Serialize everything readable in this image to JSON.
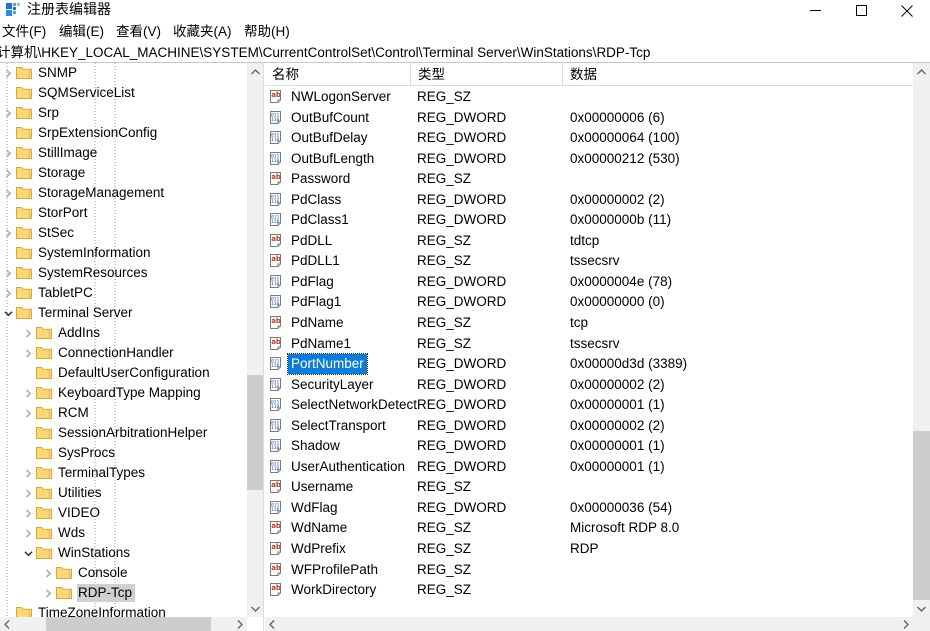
{
  "window": {
    "title": "注册表编辑器",
    "app_icon": "registry-editor-icon",
    "controls": {
      "minimize": "minimize-icon",
      "maximize": "maximize-icon",
      "close": "close-icon"
    }
  },
  "menubar": {
    "items": [
      {
        "label": "文件(F)"
      },
      {
        "label": "编辑(E)"
      },
      {
        "label": "查看(V)"
      },
      {
        "label": "收藏夹(A)"
      },
      {
        "label": "帮助(H)"
      }
    ]
  },
  "address": {
    "path": "计算机\\HKEY_LOCAL_MACHINE\\SYSTEM\\CurrentControlSet\\Control\\Terminal Server\\WinStations\\RDP-Tcp"
  },
  "tree": {
    "nodes": [
      {
        "label": "SNMP",
        "depth": 1,
        "twist": "collapsed",
        "selected": false
      },
      {
        "label": "SQMServiceList",
        "depth": 1,
        "twist": "none",
        "selected": false
      },
      {
        "label": "Srp",
        "depth": 1,
        "twist": "collapsed",
        "selected": false
      },
      {
        "label": "SrpExtensionConfig",
        "depth": 1,
        "twist": "none",
        "selected": false
      },
      {
        "label": "StillImage",
        "depth": 1,
        "twist": "collapsed",
        "selected": false
      },
      {
        "label": "Storage",
        "depth": 1,
        "twist": "collapsed",
        "selected": false
      },
      {
        "label": "StorageManagement",
        "depth": 1,
        "twist": "collapsed",
        "selected": false
      },
      {
        "label": "StorPort",
        "depth": 1,
        "twist": "none",
        "selected": false
      },
      {
        "label": "StSec",
        "depth": 1,
        "twist": "collapsed",
        "selected": false
      },
      {
        "label": "SystemInformation",
        "depth": 1,
        "twist": "none",
        "selected": false
      },
      {
        "label": "SystemResources",
        "depth": 1,
        "twist": "collapsed",
        "selected": false
      },
      {
        "label": "TabletPC",
        "depth": 1,
        "twist": "collapsed",
        "selected": false
      },
      {
        "label": "Terminal Server",
        "depth": 1,
        "twist": "expanded",
        "selected": false
      },
      {
        "label": "AddIns",
        "depth": 2,
        "twist": "collapsed",
        "selected": false
      },
      {
        "label": "ConnectionHandler",
        "depth": 2,
        "twist": "collapsed",
        "selected": false
      },
      {
        "label": "DefaultUserConfiguration",
        "depth": 2,
        "twist": "none",
        "selected": false
      },
      {
        "label": "KeyboardType Mapping",
        "depth": 2,
        "twist": "collapsed",
        "selected": false
      },
      {
        "label": "RCM",
        "depth": 2,
        "twist": "collapsed",
        "selected": false
      },
      {
        "label": "SessionArbitrationHelper",
        "depth": 2,
        "twist": "none",
        "selected": false
      },
      {
        "label": "SysProcs",
        "depth": 2,
        "twist": "none",
        "selected": false
      },
      {
        "label": "TerminalTypes",
        "depth": 2,
        "twist": "collapsed",
        "selected": false
      },
      {
        "label": "Utilities",
        "depth": 2,
        "twist": "collapsed",
        "selected": false
      },
      {
        "label": "VIDEO",
        "depth": 2,
        "twist": "collapsed",
        "selected": false
      },
      {
        "label": "Wds",
        "depth": 2,
        "twist": "collapsed",
        "selected": false
      },
      {
        "label": "WinStations",
        "depth": 2,
        "twist": "expanded",
        "selected": false
      },
      {
        "label": "Console",
        "depth": 3,
        "twist": "collapsed",
        "selected": false
      },
      {
        "label": "RDP-Tcp",
        "depth": 3,
        "twist": "collapsed",
        "selected": true
      },
      {
        "label": "TimeZoneInformation",
        "depth": 1,
        "twist": "none",
        "selected": false
      }
    ]
  },
  "list": {
    "columns": [
      {
        "label": "名称"
      },
      {
        "label": "类型"
      },
      {
        "label": "数据"
      }
    ],
    "rows": [
      {
        "name": "NWLogonServer",
        "type": "REG_SZ",
        "data": "",
        "icon": "string-value-icon",
        "selected": false
      },
      {
        "name": "OutBufCount",
        "type": "REG_DWORD",
        "data": "0x00000006 (6)",
        "icon": "dword-value-icon",
        "selected": false
      },
      {
        "name": "OutBufDelay",
        "type": "REG_DWORD",
        "data": "0x00000064 (100)",
        "icon": "dword-value-icon",
        "selected": false
      },
      {
        "name": "OutBufLength",
        "type": "REG_DWORD",
        "data": "0x00000212 (530)",
        "icon": "dword-value-icon",
        "selected": false
      },
      {
        "name": "Password",
        "type": "REG_SZ",
        "data": "",
        "icon": "string-value-icon",
        "selected": false
      },
      {
        "name": "PdClass",
        "type": "REG_DWORD",
        "data": "0x00000002 (2)",
        "icon": "dword-value-icon",
        "selected": false
      },
      {
        "name": "PdClass1",
        "type": "REG_DWORD",
        "data": "0x0000000b (11)",
        "icon": "dword-value-icon",
        "selected": false
      },
      {
        "name": "PdDLL",
        "type": "REG_SZ",
        "data": "tdtcp",
        "icon": "string-value-icon",
        "selected": false
      },
      {
        "name": "PdDLL1",
        "type": "REG_SZ",
        "data": "tssecsrv",
        "icon": "string-value-icon",
        "selected": false
      },
      {
        "name": "PdFlag",
        "type": "REG_DWORD",
        "data": "0x0000004e (78)",
        "icon": "dword-value-icon",
        "selected": false
      },
      {
        "name": "PdFlag1",
        "type": "REG_DWORD",
        "data": "0x00000000 (0)",
        "icon": "dword-value-icon",
        "selected": false
      },
      {
        "name": "PdName",
        "type": "REG_SZ",
        "data": "tcp",
        "icon": "string-value-icon",
        "selected": false
      },
      {
        "name": "PdName1",
        "type": "REG_SZ",
        "data": "tssecsrv",
        "icon": "string-value-icon",
        "selected": false
      },
      {
        "name": "PortNumber",
        "type": "REG_DWORD",
        "data": "0x00000d3d (3389)",
        "icon": "dword-value-icon",
        "selected": true
      },
      {
        "name": "SecurityLayer",
        "type": "REG_DWORD",
        "data": "0x00000002 (2)",
        "icon": "dword-value-icon",
        "selected": false
      },
      {
        "name": "SelectNetworkDetect",
        "type": "REG_DWORD",
        "data": "0x00000001 (1)",
        "icon": "dword-value-icon",
        "selected": false
      },
      {
        "name": "SelectTransport",
        "type": "REG_DWORD",
        "data": "0x00000002 (2)",
        "icon": "dword-value-icon",
        "selected": false
      },
      {
        "name": "Shadow",
        "type": "REG_DWORD",
        "data": "0x00000001 (1)",
        "icon": "dword-value-icon",
        "selected": false
      },
      {
        "name": "UserAuthentication",
        "type": "REG_DWORD",
        "data": "0x00000001 (1)",
        "icon": "dword-value-icon",
        "selected": false
      },
      {
        "name": "Username",
        "type": "REG_SZ",
        "data": "",
        "icon": "string-value-icon",
        "selected": false
      },
      {
        "name": "WdFlag",
        "type": "REG_DWORD",
        "data": "0x00000036 (54)",
        "icon": "dword-value-icon",
        "selected": false
      },
      {
        "name": "WdName",
        "type": "REG_SZ",
        "data": "Microsoft RDP 8.0",
        "icon": "string-value-icon",
        "selected": false
      },
      {
        "name": "WdPrefix",
        "type": "REG_SZ",
        "data": "RDP",
        "icon": "string-value-icon",
        "selected": false
      },
      {
        "name": "WFProfilePath",
        "type": "REG_SZ",
        "data": "",
        "icon": "string-value-icon",
        "selected": false
      },
      {
        "name": "WorkDirectory",
        "type": "REG_SZ",
        "data": "",
        "icon": "string-value-icon",
        "selected": false
      }
    ]
  },
  "colors": {
    "selection_blue": "#0a7ddb",
    "inactive_selection": "#d0d0d0",
    "folder_yellow": "#fcd975",
    "scrollbar_track": "#f0f0f0",
    "scrollbar_thumb": "#cdcdcd"
  }
}
